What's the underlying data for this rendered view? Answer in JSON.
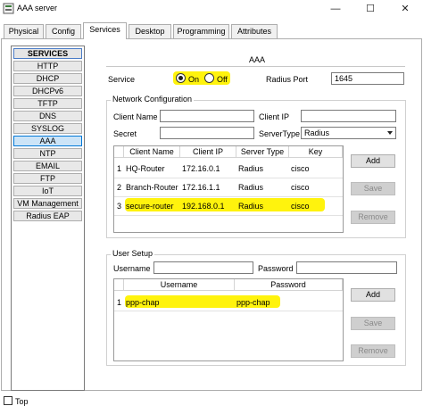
{
  "window": {
    "title": "AAA server"
  },
  "tabs": [
    {
      "label": "Physical"
    },
    {
      "label": "Config"
    },
    {
      "label": "Services"
    },
    {
      "label": "Desktop"
    },
    {
      "label": "Programming"
    },
    {
      "label": "Attributes"
    }
  ],
  "sidebar": {
    "items": [
      {
        "label": "SERVICES"
      },
      {
        "label": "HTTP"
      },
      {
        "label": "DHCP"
      },
      {
        "label": "DHCPv6"
      },
      {
        "label": "TFTP"
      },
      {
        "label": "DNS"
      },
      {
        "label": "SYSLOG"
      },
      {
        "label": "AAA"
      },
      {
        "label": "NTP"
      },
      {
        "label": "EMAIL"
      },
      {
        "label": "FTP"
      },
      {
        "label": "IoT"
      },
      {
        "label": "VM Management"
      },
      {
        "label": "Radius EAP"
      }
    ]
  },
  "aaa": {
    "title": "AAA",
    "service_label": "Service",
    "on_label": "On",
    "off_label": "Off",
    "radius_port_label": "Radius Port",
    "radius_port_value": "1645"
  },
  "network_config": {
    "group_label": "Network Configuration",
    "client_name_label": "Client Name",
    "client_ip_label": "Client IP",
    "secret_label": "Secret",
    "server_type_label": "ServerType",
    "server_type_value": "Radius",
    "columns": [
      "Client Name",
      "Client IP",
      "Server Type",
      "Key"
    ],
    "rows": [
      {
        "num": "1",
        "client_name": "HQ-Router",
        "client_ip": "172.16.0.1",
        "server_type": "Radius",
        "key": "cisco"
      },
      {
        "num": "2",
        "client_name": "Branch-Router",
        "client_ip": "172.16.1.1",
        "server_type": "Radius",
        "key": "cisco"
      },
      {
        "num": "3",
        "client_name": "secure-router",
        "client_ip": "192.168.0.1",
        "server_type": "Radius",
        "key": "cisco"
      }
    ],
    "buttons": {
      "add": "Add",
      "save": "Save",
      "remove": "Remove"
    }
  },
  "user_setup": {
    "group_label": "User Setup",
    "username_label": "Username",
    "password_label": "Password",
    "columns": [
      "Username",
      "Password"
    ],
    "rows": [
      {
        "num": "1",
        "username": "ppp-chap",
        "password": "ppp-chap"
      }
    ],
    "buttons": {
      "add": "Add",
      "save": "Save",
      "remove": "Remove"
    }
  },
  "footer": {
    "top_label": "Top"
  },
  "colors": {
    "highlight": "#fff200",
    "selected": "#cce4f7"
  }
}
